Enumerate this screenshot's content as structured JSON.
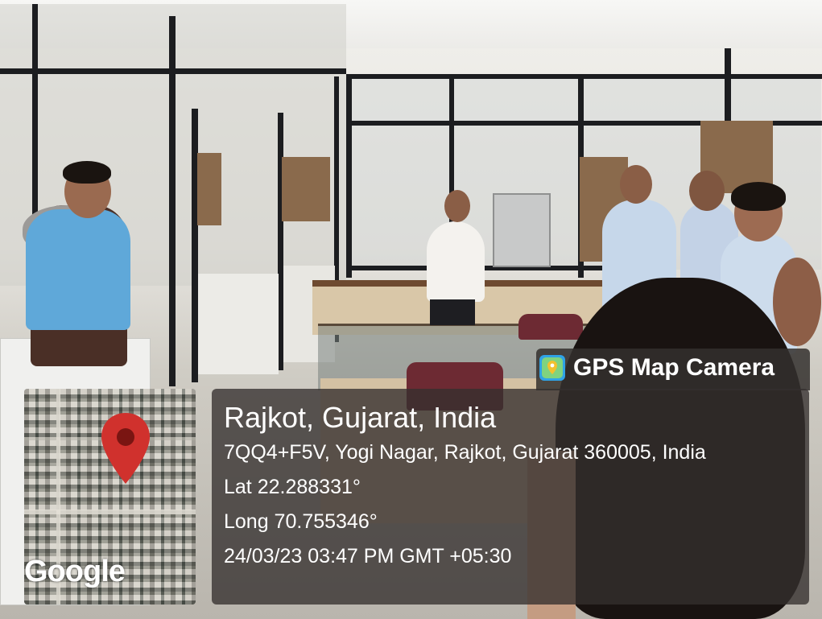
{
  "app": {
    "badge_title": "GPS Map Camera",
    "map_brand": "Google"
  },
  "location": {
    "city": "Rajkot, Gujarat, India",
    "address": "7QQ4+F5V, Yogi Nagar, Rajkot, Gujarat 360005, India",
    "lat": "Lat 22.288331°",
    "long": "Long 70.755346°",
    "datetime": "24/03/23 03:47 PM GMT +05:30"
  },
  "colors": {
    "pin": "#d0312d",
    "badge_icon": "#2fa3e6",
    "overlay": "#34302e"
  },
  "icons": [
    "map-pin-icon",
    "gps-map-camera-app-icon"
  ]
}
